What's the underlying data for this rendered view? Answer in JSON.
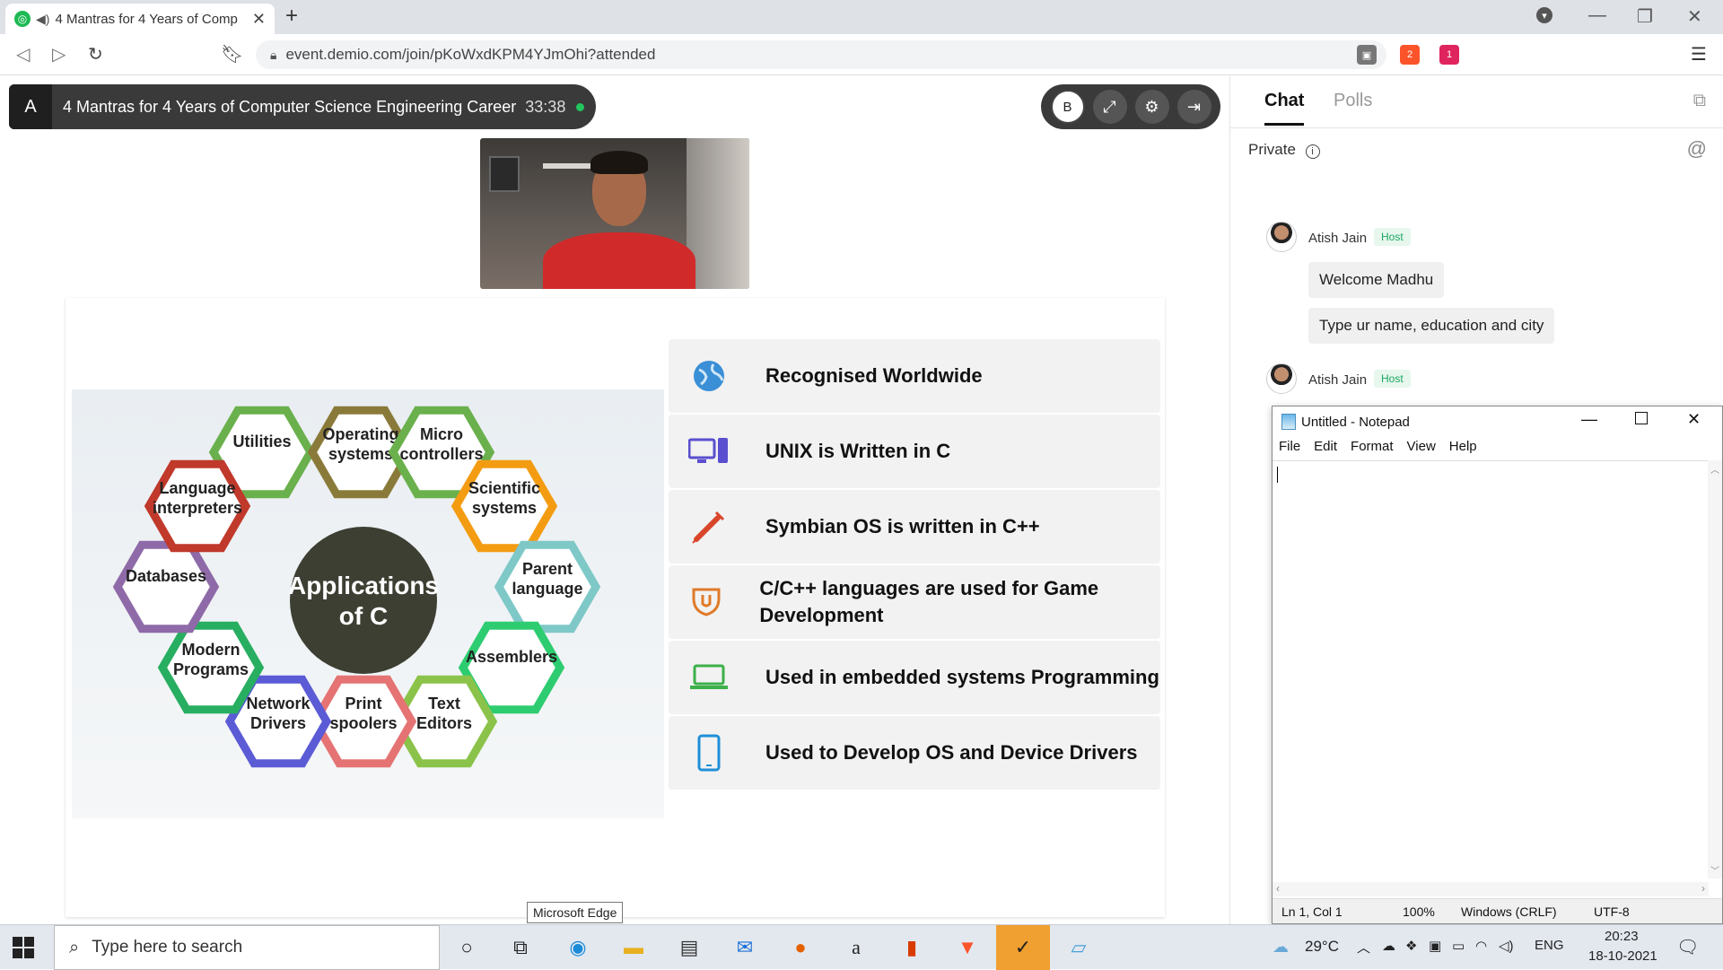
{
  "browser": {
    "tab_title": "4 Mantras for 4 Years of Comp",
    "url": "event.demio.com/join/pKoWxdKPM4YJmOhi?attended",
    "ext_badge_1": "2",
    "ext_badge_2": "1"
  },
  "webinar": {
    "avatar_letter": "A",
    "title": "4 Mantras for 4 Years of Computer Science Engineering Career",
    "timer": "33:38",
    "control_user_letter": "B"
  },
  "slide": {
    "diagram_center": [
      "Applications",
      "of C"
    ],
    "hexagons": [
      {
        "lines": [
          "Utilities"
        ],
        "color": "#6ab04c"
      },
      {
        "lines": [
          "Operating",
          "systems"
        ],
        "color": "#8a7a3a"
      },
      {
        "lines": [
          "Micro",
          "controllers"
        ],
        "color": "#6ab04c"
      },
      {
        "lines": [
          "Scientific",
          "systems"
        ],
        "color": "#f39c12"
      },
      {
        "lines": [
          "Parent",
          "language"
        ],
        "color": "#7fc8c8"
      },
      {
        "lines": [
          "Assemblers"
        ],
        "color": "#2ecc71"
      },
      {
        "lines": [
          "Text",
          "Editors"
        ],
        "color": "#8bc34a"
      },
      {
        "lines": [
          "Print",
          "spoolers"
        ],
        "color": "#e57373"
      },
      {
        "lines": [
          "Network",
          "Drivers"
        ],
        "color": "#5b5bd6"
      },
      {
        "lines": [
          "Modern",
          "Programs"
        ],
        "color": "#27ae60"
      },
      {
        "lines": [
          "Databases"
        ],
        "color": "#8e6aa8"
      },
      {
        "lines": [
          "Language",
          "interpreters"
        ],
        "color": "#c0392b"
      }
    ],
    "features": [
      {
        "label": "Recognised Worldwide",
        "icon": "globe-icon"
      },
      {
        "label": "UNIX is Written in C",
        "icon": "computer-icon"
      },
      {
        "label": "Symbian OS is written in C++",
        "icon": "syringe-icon"
      },
      {
        "label": "C/C++ languages are used for Game Development",
        "icon": "game-shield-icon"
      },
      {
        "label": "Used in embedded systems Programming",
        "icon": "laptop-icon"
      },
      {
        "label": "Used to Develop OS and Device Drivers",
        "icon": "phone-icon"
      }
    ]
  },
  "tooltip": "Microsoft Edge",
  "panel": {
    "tab_chat": "Chat",
    "tab_polls": "Polls",
    "private_label": "Private",
    "messages": [
      {
        "author": "Atish Jain",
        "badge": "Host",
        "bubbles": [
          "Welcome  Madhu",
          "Type ur name, education and city"
        ]
      },
      {
        "author": "Atish Jain",
        "badge": "Host",
        "bubbles": []
      }
    ]
  },
  "notepad": {
    "title": "Untitled - Notepad",
    "menu": [
      "File",
      "Edit",
      "Format",
      "View",
      "Help"
    ],
    "status_pos": "Ln 1, Col 1",
    "status_zoom": "100%",
    "status_eol": "Windows (CRLF)",
    "status_enc": "UTF-8"
  },
  "taskbar": {
    "search_placeholder": "Type here to search",
    "weather": "29°C",
    "lang": "ENG",
    "time": "20:23",
    "date": "18-10-2021"
  },
  "colors": {
    "accent": "#22c55e",
    "dark_pill": "#3a3a3a",
    "host_green": "#1aa760"
  }
}
